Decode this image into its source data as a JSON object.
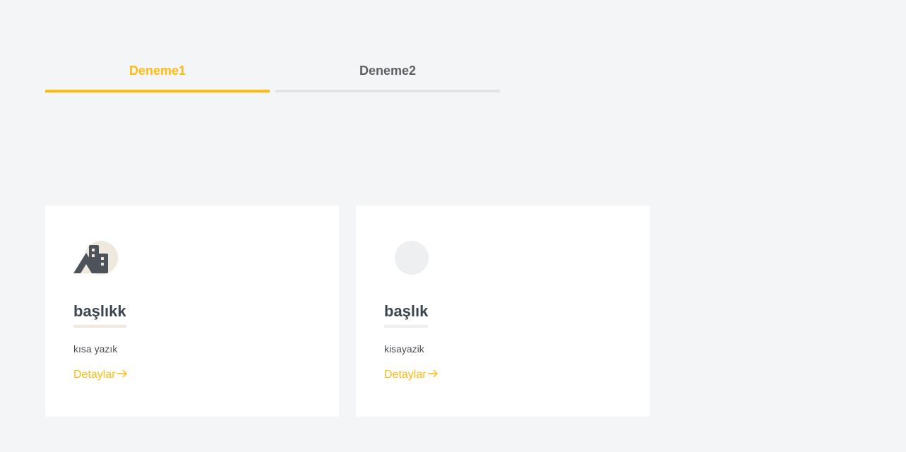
{
  "tabs": [
    {
      "label": "Deneme1",
      "active": true
    },
    {
      "label": "Deneme2",
      "active": false
    }
  ],
  "cards": [
    {
      "icon": "city-mountain-icon",
      "title": "başlıkk",
      "text": "kısa yazık",
      "link": "Detaylar"
    },
    {
      "icon": "placeholder-circle-icon",
      "title": "başlık",
      "text": "kisayazik",
      "link": "Detaylar"
    }
  ],
  "colors": {
    "accent": "#ffbb0f",
    "background": "#f4f5f7",
    "title": "#3b4650"
  }
}
